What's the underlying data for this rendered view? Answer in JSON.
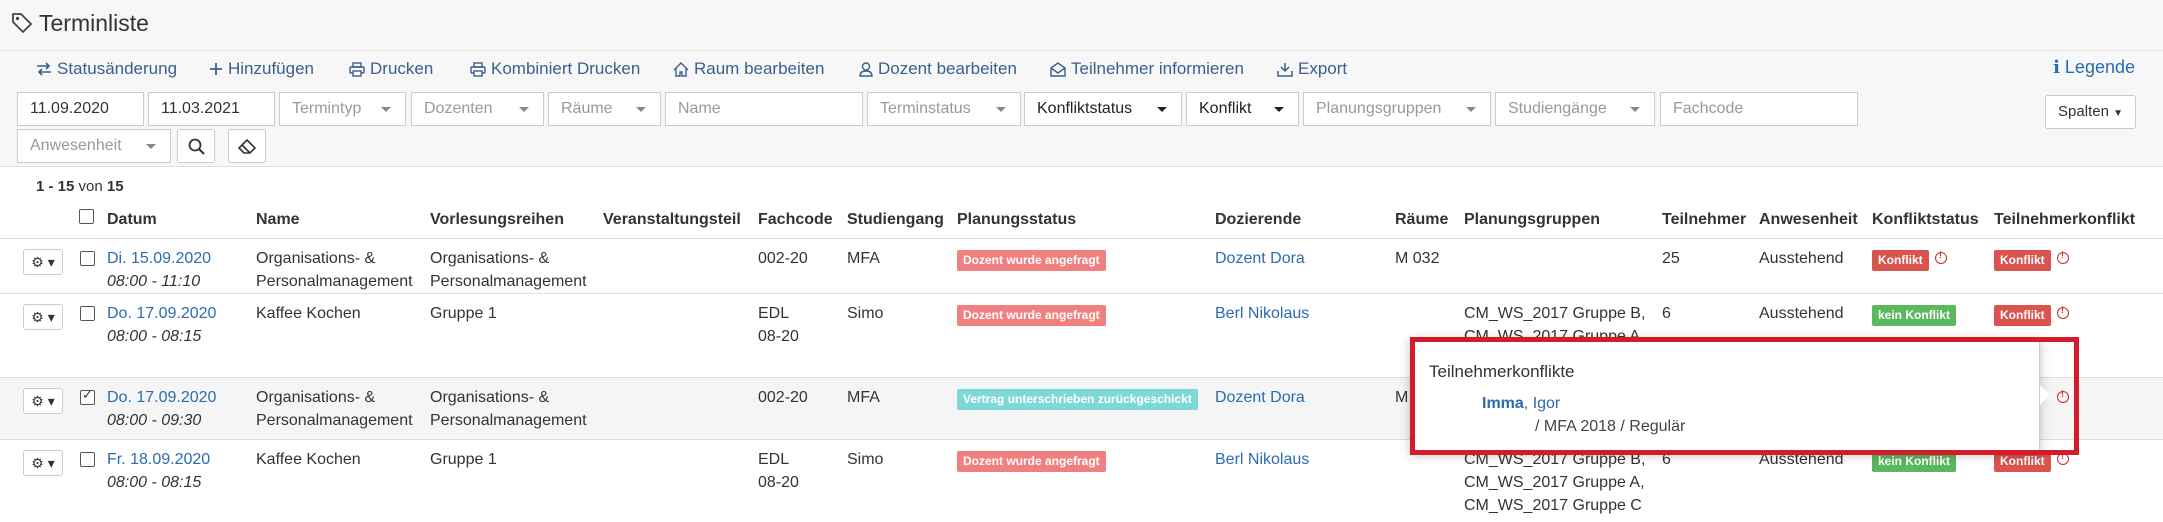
{
  "header": {
    "title": "Terminliste"
  },
  "toolbar": {
    "status": "Statusänderung",
    "add": "Hinzufügen",
    "print": "Drucken",
    "combined_print": "Kombiniert Drucken",
    "edit_room": "Raum bearbeiten",
    "edit_lecturer": "Dozent bearbeiten",
    "notify": "Teilnehmer informieren",
    "export": "Export",
    "legend": "Legende"
  },
  "filters": {
    "date_from": "11.09.2020",
    "date_to": "11.03.2021",
    "termintyp": "Termintyp",
    "dozenten": "Dozenten",
    "raeume": "Räume",
    "name_placeholder": "Name",
    "terminstatus": "Terminstatus",
    "konfliktstatus": "Konfliktstatus",
    "konflikt": "Konflikt",
    "planungsgruppen": "Planungsgruppen",
    "studiengaenge": "Studiengänge",
    "fachcode_placeholder": "Fachcode",
    "anwesenheit": "Anwesenheit",
    "spalten": "Spalten"
  },
  "pagination": {
    "range": "1 - 15",
    "of": "von",
    "total": "15"
  },
  "columns": [
    "Datum",
    "Name",
    "Vorlesungsreihen",
    "Veranstaltungsteil",
    "Fachcode",
    "Studiengang",
    "Planungsstatus",
    "Dozierende",
    "Räume",
    "Planungsgruppen",
    "Teilnehmer",
    "Anwesenheit",
    "Konfliktstatus",
    "Teilnehmerkonflikt"
  ],
  "rows": [
    {
      "date": "Di. 15.09.2020",
      "time": "08:00 - 11:10",
      "name_1": "Organisations- &",
      "name_2": "Personalmanagement",
      "reihe_1": "Organisations- &",
      "reihe_2": "Personalmanagement",
      "fachcode_1": "002-20",
      "fachcode_2": "",
      "studiengang": "MFA",
      "planungsstatus": "Dozent wurde angefragt",
      "dozent": "Dozent Dora",
      "raum": "M 032",
      "gruppen": "",
      "teilnehmer": "25",
      "anwesenheit": "Ausstehend",
      "konfliktstatus": "Konflikt",
      "tkonflikt": "Konflikt",
      "checked": false
    },
    {
      "date": "Do. 17.09.2020",
      "time": "08:00 - 08:15",
      "name_1": "Kaffee Kochen",
      "name_2": "",
      "reihe_1": "Gruppe 1",
      "reihe_2": "",
      "fachcode_1": "EDL",
      "fachcode_2": "08-20",
      "studiengang": "Simo",
      "planungsstatus": "Dozent wurde angefragt",
      "dozent": "Berl Nikolaus",
      "raum": "",
      "gruppen": "CM_WS_2017 Gruppe B,",
      "gruppen_2": "CM_WS_2017 Gruppe A,",
      "teilnehmer": "6",
      "anwesenheit": "Ausstehend",
      "konfliktstatus": "kein Konflikt",
      "tkonflikt": "Konflikt",
      "checked": false
    },
    {
      "date": "Do. 17.09.2020",
      "time": "08:00 - 09:30",
      "name_1": "Organisations- &",
      "name_2": "Personalmanagement",
      "reihe_1": "Organisations- &",
      "reihe_2": "Personalmanagement",
      "fachcode_1": "002-20",
      "fachcode_2": "",
      "studiengang": "MFA",
      "planungsstatus": "Vertrag unterschrieben zurückgeschickt",
      "dozent": "Dozent Dora",
      "raum": "M",
      "checked": true
    },
    {
      "date": "Fr. 18.09.2020",
      "time": "08:00 - 08:15",
      "name_1": "Kaffee Kochen",
      "name_2": "",
      "reihe_1": "Gruppe 1",
      "reihe_2": "",
      "fachcode_1": "EDL",
      "fachcode_2": "08-20",
      "studiengang": "Simo",
      "planungsstatus": "Dozent wurde angefragt",
      "dozent": "Berl Nikolaus",
      "raum": "",
      "gruppen": "CM_WS_2017 Gruppe B,",
      "gruppen_2": "CM_WS_2017 Gruppe A,",
      "gruppen_3": "CM_WS_2017 Gruppe C",
      "teilnehmer": "6",
      "anwesenheit": "Ausstehend",
      "konfliktstatus": "kein Konflikt",
      "tkonflikt": "Konflikt",
      "checked": false
    }
  ],
  "popover": {
    "title": "Teilnehmerkonflikte",
    "last_name": "Imma",
    "first_name": ", Igor",
    "detail": "/ MFA 2018 / Regulär"
  },
  "colors": {
    "link": "#2a6cb0",
    "highlight": "#d21c2b",
    "badge_red": "#f08080",
    "badge_cyan": "#7ed8d6",
    "badge_dark_red": "#d9534f",
    "badge_green": "#5cb85c"
  }
}
